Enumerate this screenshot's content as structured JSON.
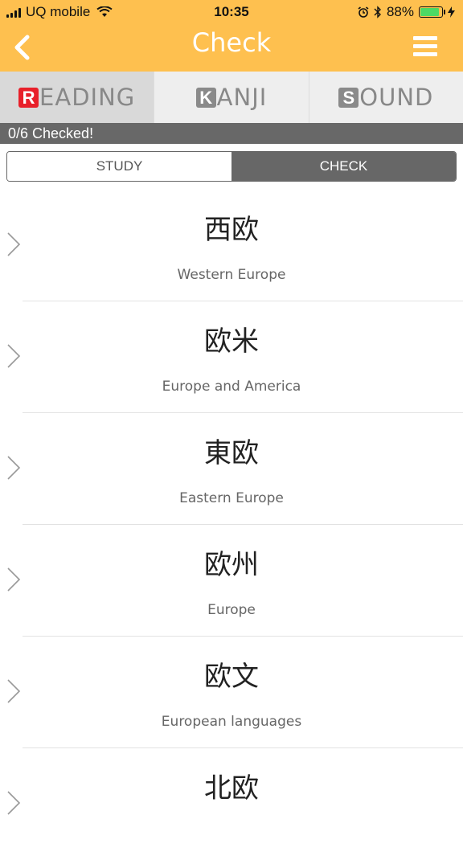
{
  "status_bar": {
    "carrier": "UQ mobile",
    "time": "10:35",
    "battery_percent": "88%",
    "battery_level": 0.88
  },
  "navbar": {
    "title": "Check",
    "background": "#fec04f"
  },
  "tabs": [
    {
      "initial": "R",
      "rest": "EADING",
      "color": "#e8202a",
      "active": true
    },
    {
      "initial": "K",
      "rest": "ANJI",
      "color": "#8a8a8a",
      "active": false
    },
    {
      "initial": "S",
      "rest": "OUND",
      "color": "#8a8a8a",
      "active": false
    }
  ],
  "progress": {
    "text": "0/6 Checked!",
    "checked": 0,
    "total": 6
  },
  "segment": {
    "study_label": "STUDY",
    "check_label": "CHECK",
    "selected": "CHECK"
  },
  "items": [
    {
      "kanji": "西欧",
      "meaning": "Western Europe"
    },
    {
      "kanji": "欧米",
      "meaning": "Europe and America"
    },
    {
      "kanji": "東欧",
      "meaning": "Eastern Europe"
    },
    {
      "kanji": "欧州",
      "meaning": "Europe"
    },
    {
      "kanji": "欧文",
      "meaning": "European languages"
    },
    {
      "kanji": "北欧",
      "meaning": ""
    }
  ]
}
